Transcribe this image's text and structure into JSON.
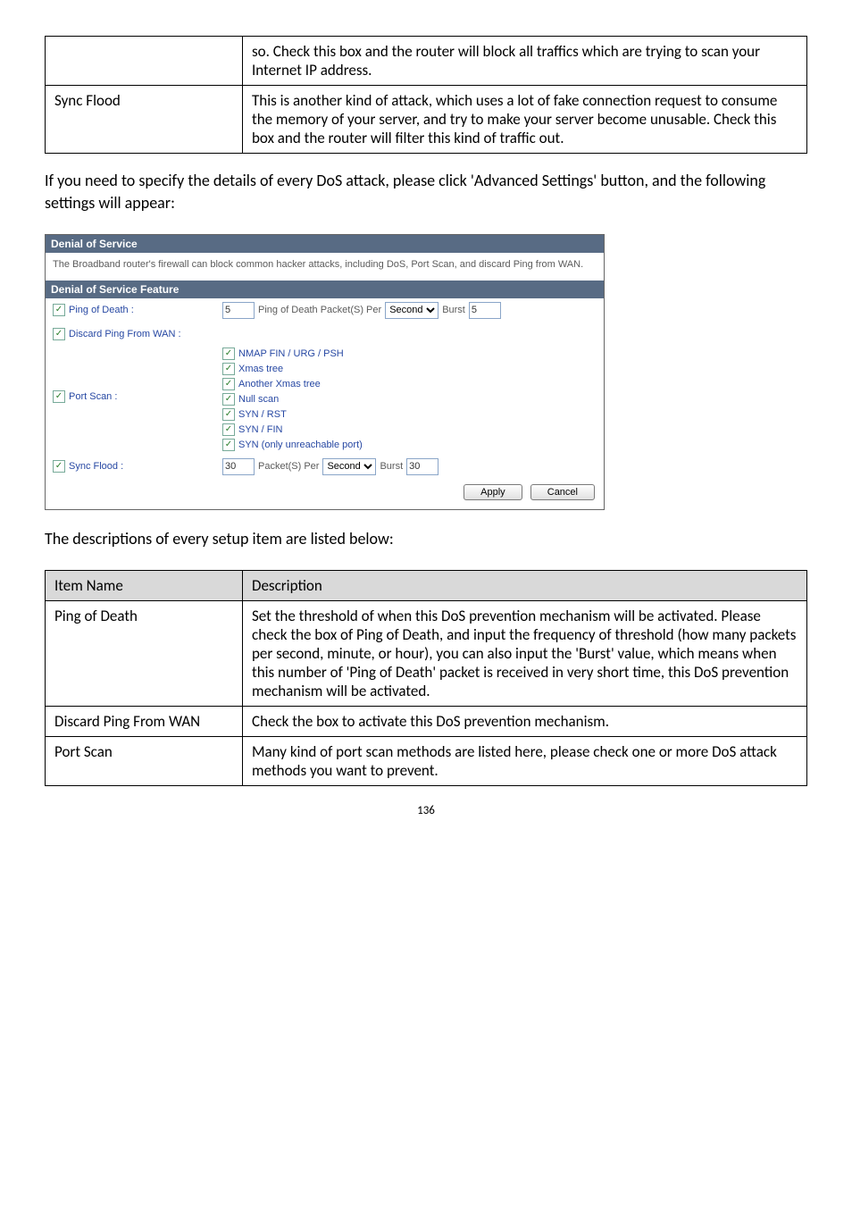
{
  "table1": {
    "rows": [
      {
        "left": "",
        "right": "so. Check this box and the router will block all traffics which are trying to scan your Internet IP address."
      },
      {
        "left": "Sync Flood",
        "right": "This is another kind of attack, which uses a lot of fake connection request to consume the memory of your server, and try to make your server become unusable. Check this box and the router will filter this kind of traffic out."
      }
    ]
  },
  "para1": "If you need to specify the details of every DoS attack, please click 'Advanced Settings' button, and the following settings will appear:",
  "dos": {
    "title": "Denial of Service",
    "desc": "The Broadband router's firewall can block common hacker attacks, including DoS, Port Scan, and discard Ping from WAN.",
    "feature_title": "Denial of Service Feature",
    "ping_of_death": "Ping of Death :",
    "ping_ctrl_label": "Ping of Death Packet(S) Per",
    "ping_value": "5",
    "ping_unit": "Second",
    "ping_burst_label": "Burst",
    "ping_burst_value": "5",
    "discard_ping": "Discard Ping From WAN :",
    "port_scan": "Port Scan :",
    "opts": [
      "NMAP FIN / URG / PSH",
      "Xmas tree",
      "Another Xmas tree",
      "Null scan",
      "SYN / RST",
      "SYN / FIN",
      "SYN (only unreachable port)"
    ],
    "sync_flood": "Sync Flood :",
    "sync_value": "30",
    "sync_label": "Packet(S) Per",
    "sync_unit": "Second",
    "sync_burst_label": "Burst",
    "sync_burst_value": "30",
    "apply": "Apply",
    "cancel": "Cancel"
  },
  "para2": "The descriptions of every setup item are listed below:",
  "table2": {
    "header": {
      "left": "Item Name",
      "right": "Description"
    },
    "rows": [
      {
        "left": "Ping of Death",
        "right": "Set the threshold of when this DoS prevention mechanism will be activated. Please check the box of Ping of Death, and input the frequency of threshold (how many packets per second, minute, or hour), you can also input the 'Burst' value, which means when this number of 'Ping of Death' packet is received in very short time, this DoS prevention mechanism will be activated."
      },
      {
        "left": "Discard Ping From WAN",
        "right": "Check the box to activate this DoS prevention mechanism."
      },
      {
        "left": "Port Scan",
        "right": "Many kind of port scan methods are listed here, please check one or more DoS attack methods you want to prevent."
      }
    ]
  },
  "pagenum": "136"
}
